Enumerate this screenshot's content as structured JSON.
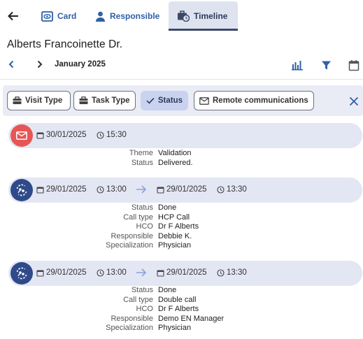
{
  "tabs": {
    "card": "Card",
    "responsible": "Responsible",
    "timeline": "Timeline"
  },
  "page_title": "Alberts Francoinette Dr.",
  "month": "January 2025",
  "filters": {
    "visit_type": "Visit Type",
    "task_type": "Task Type",
    "status": "Status",
    "remote": "Remote communications"
  },
  "entries": [
    {
      "icon": "mail-icon",
      "color": "#e85555",
      "start_date": "30/01/2025",
      "start_time": "15:30",
      "details": [
        {
          "label": "Theme",
          "value": "Validation"
        },
        {
          "label": "Status",
          "value": "Delivered."
        }
      ]
    },
    {
      "icon": "visit-icon",
      "color": "#2f4a8a",
      "start_date": "29/01/2025",
      "start_time": "13:00",
      "end_date": "29/01/2025",
      "end_time": "13:30",
      "details": [
        {
          "label": "Status",
          "value": "Done"
        },
        {
          "label": "Call type",
          "value": "HCP Call"
        },
        {
          "label": "HCO",
          "value": "Dr F Alberts"
        },
        {
          "label": "Responsible",
          "value": "Debbie K."
        },
        {
          "label": "Specialization",
          "value": "Physician"
        }
      ]
    },
    {
      "icon": "visit-icon",
      "color": "#2f4a8a",
      "start_date": "29/01/2025",
      "start_time": "13:00",
      "end_date": "29/01/2025",
      "end_time": "13:30",
      "details": [
        {
          "label": "Status",
          "value": "Done"
        },
        {
          "label": "Call type",
          "value": "Double call"
        },
        {
          "label": "HCO",
          "value": "Dr F Alberts"
        },
        {
          "label": "Responsible",
          "value": "Demo EN Manager"
        },
        {
          "label": "Specialization",
          "value": "Physician"
        }
      ]
    }
  ],
  "colors": {
    "accent": "#2f5fa7",
    "chip_active": "#c9d3f0",
    "header_bg": "#e3e6f3"
  }
}
